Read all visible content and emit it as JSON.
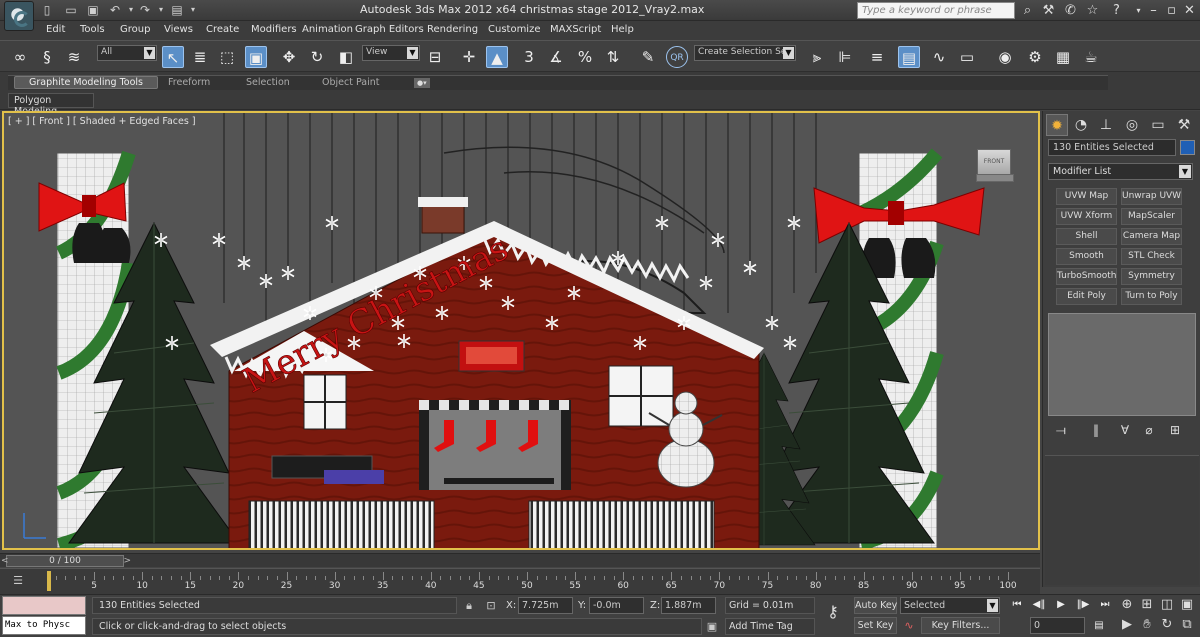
{
  "window": {
    "title": "Autodesk 3ds Max  2012 x64       christmas stage 2012_Vray2.max",
    "search_placeholder": "Type a keyword or phrase"
  },
  "menu": [
    "Edit",
    "Tools",
    "Group",
    "Views",
    "Create",
    "Modifiers",
    "Animation",
    "Graph Editors",
    "Rendering",
    "Customize",
    "MAXScript",
    "Help"
  ],
  "toolbar": {
    "selection_filter": "All",
    "reference_coord": "View",
    "named_selection_placeholder": "Create Selection Se",
    "snap_label": "3"
  },
  "ribbon": {
    "tabs": [
      "Graphite Modeling Tools",
      "Freeform",
      "Selection",
      "Object Paint"
    ],
    "active_tab": "Graphite Modeling Tools",
    "panel_label": "Polygon Modeling"
  },
  "viewport": {
    "label": "[ + ] [ Front ] [ Shaded + Edged Faces ]",
    "viewcube_face": "FRONT",
    "scene_text": "Merry Christmas"
  },
  "command_panel": {
    "selection_name": "130 Entities Selected",
    "object_color": "#1f5fb5",
    "modifier_list": "Modifier List",
    "modifier_buttons": [
      "UVW Map",
      "Unwrap UVW",
      "UVW Xform",
      "MapScaler",
      "Shell",
      "Camera Map",
      "Smooth",
      "STL Check",
      "TurboSmooth",
      "Symmetry",
      "Edit Poly",
      "Turn to Poly"
    ]
  },
  "timeline": {
    "frame_display": "0 / 100",
    "ticks": [
      "5",
      "10",
      "15",
      "20",
      "25",
      "30",
      "35",
      "40",
      "45",
      "50",
      "55",
      "60",
      "65",
      "70",
      "75",
      "80",
      "85",
      "90",
      "95",
      "100"
    ]
  },
  "status": {
    "maxscript_text": "Max to Physc",
    "selected_text": "130 Entities Selected",
    "prompt": "Click or click-and-drag to select objects",
    "x_label": "X:",
    "x_value": "7.725m",
    "y_label": "Y:",
    "y_value": "-0.0m",
    "z_label": "Z:",
    "z_value": "1.887m",
    "grid": "Grid = 0.01m",
    "add_time_tag": "Add Time Tag",
    "auto_key": "Auto Key",
    "set_key": "Set Key",
    "key_mode": "Selected",
    "key_filters": "Key Filters...",
    "current_frame": "0"
  },
  "colors": {
    "viewport_border": "#e2c14a",
    "active_tool": "#5b8fc7",
    "auto_key_bg": "#4a4a4a"
  }
}
